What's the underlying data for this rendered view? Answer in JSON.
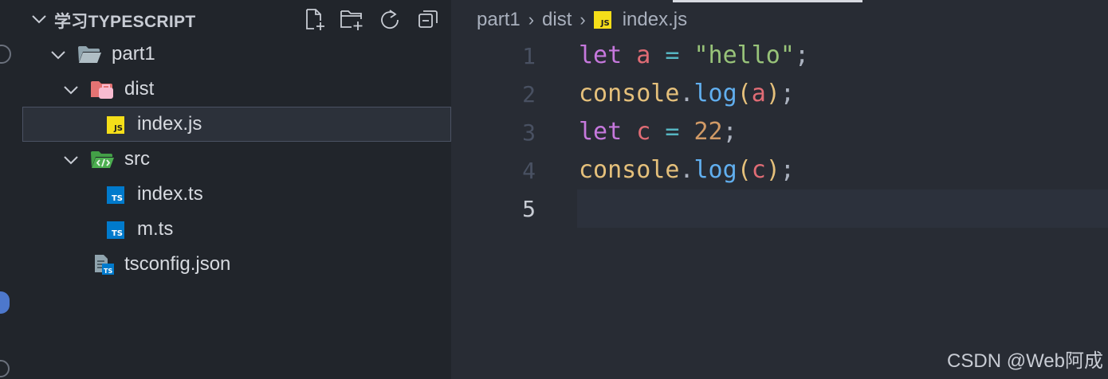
{
  "explorer": {
    "title": "学习TYPESCRIPT",
    "actions": [
      "new-file-icon",
      "new-folder-icon",
      "refresh-icon",
      "collapse-all-icon"
    ]
  },
  "tree": {
    "part1": "part1",
    "dist": "dist",
    "dist_index": "index.js",
    "src": "src",
    "src_index": "index.ts",
    "src_m": "m.ts",
    "tsconfig": "tsconfig.json",
    "js_badge": "JS",
    "ts_badge": "TS"
  },
  "breadcrumb": {
    "part1": "part1",
    "dist": "dist",
    "file": "index.js",
    "separator": "›"
  },
  "editor": {
    "line_numbers": [
      "1",
      "2",
      "3",
      "4",
      "5"
    ],
    "active_line": 5,
    "lines": [
      [
        {
          "t": "let",
          "c": "kw"
        },
        {
          "t": " ",
          "c": "punc"
        },
        {
          "t": "a",
          "c": "var"
        },
        {
          "t": " ",
          "c": "punc"
        },
        {
          "t": "=",
          "c": "op"
        },
        {
          "t": " ",
          "c": "punc"
        },
        {
          "t": "\"hello\"",
          "c": "str"
        },
        {
          "t": ";",
          "c": "punc"
        }
      ],
      [
        {
          "t": "console",
          "c": "obj"
        },
        {
          "t": ".",
          "c": "punc"
        },
        {
          "t": "log",
          "c": "fn"
        },
        {
          "t": "(",
          "c": "obj"
        },
        {
          "t": "a",
          "c": "var"
        },
        {
          "t": ")",
          "c": "obj"
        },
        {
          "t": ";",
          "c": "punc"
        }
      ],
      [
        {
          "t": "let",
          "c": "kw"
        },
        {
          "t": " ",
          "c": "punc"
        },
        {
          "t": "c",
          "c": "var"
        },
        {
          "t": " ",
          "c": "punc"
        },
        {
          "t": "=",
          "c": "op"
        },
        {
          "t": " ",
          "c": "punc"
        },
        {
          "t": "22",
          "c": "num"
        },
        {
          "t": ";",
          "c": "punc"
        }
      ],
      [
        {
          "t": "console",
          "c": "obj"
        },
        {
          "t": ".",
          "c": "punc"
        },
        {
          "t": "log",
          "c": "fn"
        },
        {
          "t": "(",
          "c": "obj"
        },
        {
          "t": "c",
          "c": "var"
        },
        {
          "t": ")",
          "c": "obj"
        },
        {
          "t": ";",
          "c": "punc"
        }
      ],
      []
    ]
  },
  "watermark": "CSDN @Web阿成",
  "colors": {
    "background": "#282c34",
    "sidebar": "#21252b",
    "keyword": "#c678dd",
    "variable": "#e06c75",
    "string": "#98c379",
    "number": "#d19a66",
    "function": "#61afef",
    "object": "#e5c07b",
    "operator": "#56b6c2"
  }
}
